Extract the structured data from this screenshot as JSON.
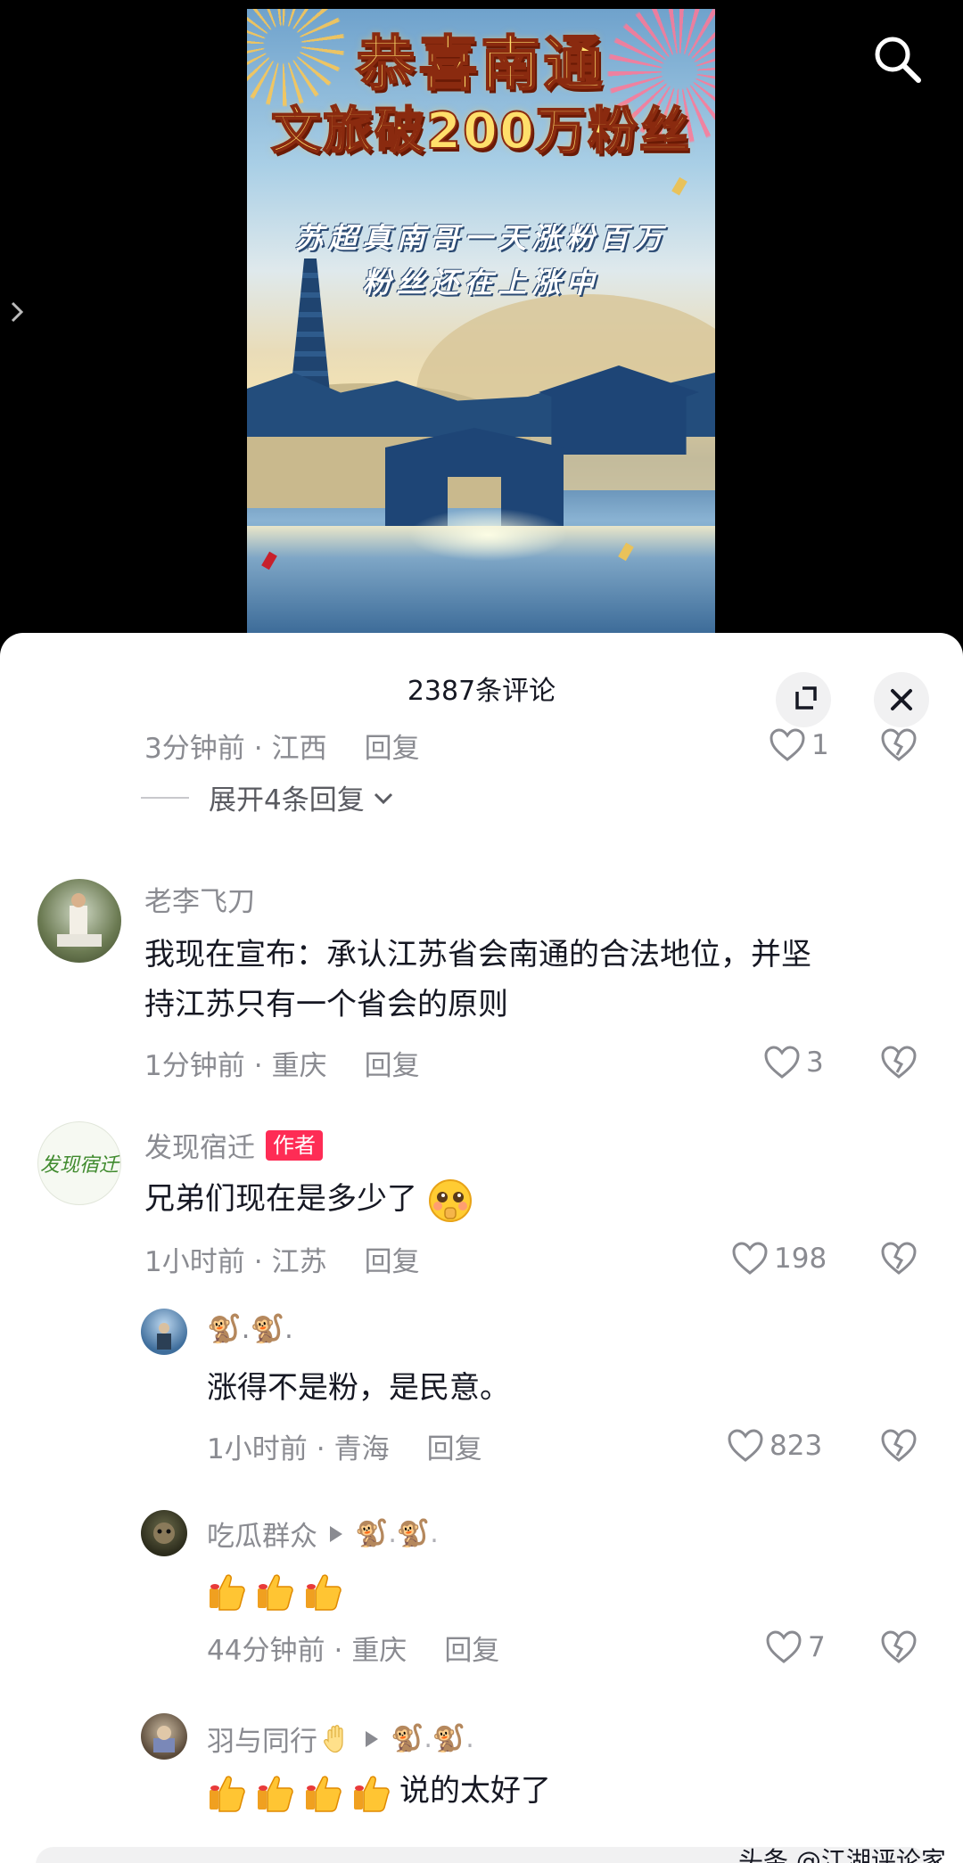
{
  "video": {
    "poster_title_line1": "恭喜南通",
    "poster_title_line2": "文旅破200万粉丝",
    "poster_sub_line1": "苏超真南哥一天涨粉百万",
    "poster_sub_line2": "粉丝还在上涨中",
    "search_icon": "search-icon",
    "side_arrow_icon": "chevron-right-icon"
  },
  "sheet": {
    "title": "2387条评论",
    "expand_icon": "expand-icon",
    "close_icon": "close-icon"
  },
  "comments": [
    {
      "time": "3分钟前",
      "location": "江西",
      "reply_label": "回复",
      "likes": "1"
    },
    {
      "expand_label": "展开4条回复"
    },
    {
      "username": "老李飞刀",
      "text_line1": "我现在宣布：承认江苏省会南通的合法地位，并坚",
      "text_line2": "持江苏只有一个省会的原则",
      "time": "1分钟前",
      "location": "重庆",
      "reply_label": "回复",
      "likes": "3"
    },
    {
      "username": "发现宿迁",
      "badge": "作者",
      "text": "兄弟们现在是多少了",
      "time": "1小时前",
      "location": "江苏",
      "reply_label": "回复",
      "likes": "198",
      "avatar_text": "发现宿迁"
    },
    {
      "username": "🐒.🐒.",
      "text": "涨得不是粉，是民意。",
      "time": "1小时前",
      "location": "青海",
      "reply_label": "回复",
      "likes": "823"
    },
    {
      "username": "吃瓜群众",
      "reply_to": "🐒.🐒.",
      "text": "",
      "time": "44分钟前",
      "location": "重庆",
      "reply_label": "回复",
      "likes": "7"
    },
    {
      "username": "羽与同行",
      "reply_to": "🐒.🐒.",
      "text": "说的太好了"
    }
  ],
  "watermark": "头条 @江湖评论家",
  "colors": {
    "text_primary": "#161823",
    "text_secondary": "#8a8b91",
    "badge_red": "#fe2c55",
    "sheet_bg": "#ffffff"
  }
}
